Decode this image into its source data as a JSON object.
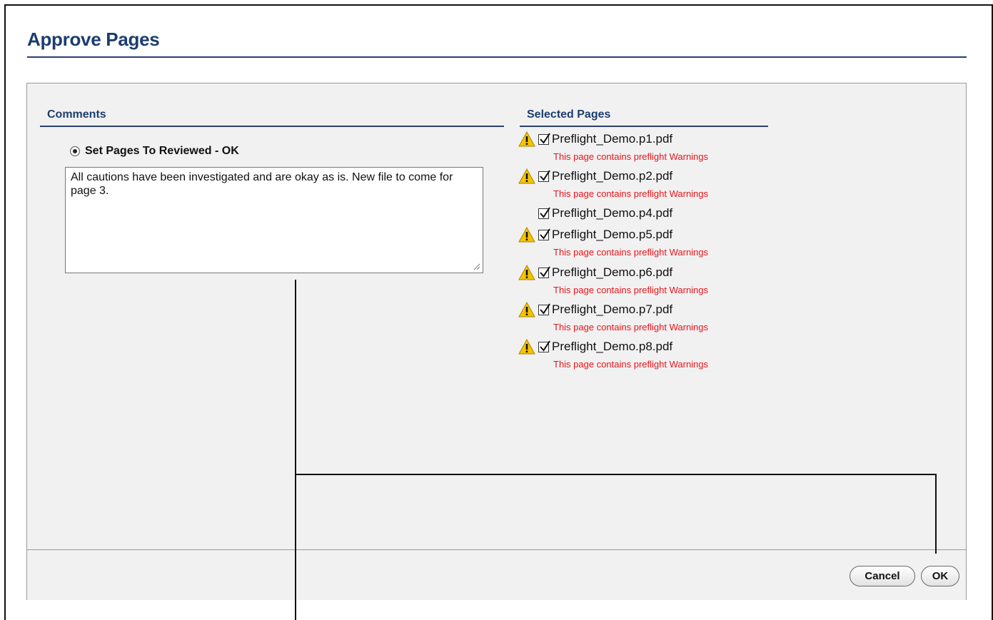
{
  "dialog": {
    "title": "Approve Pages"
  },
  "comments": {
    "heading": "Comments",
    "radio_label": "Set Pages To Reviewed - OK",
    "text": "All cautions have been investigated and are okay as is. New file to come for page 3."
  },
  "selected_pages": {
    "heading": "Selected Pages",
    "warning_text": "This page contains preflight Warnings",
    "items": [
      {
        "name": "Preflight_Demo.p1.pdf",
        "checked": true,
        "warning": "This page contains preflight Warnings"
      },
      {
        "name": "Preflight_Demo.p2.pdf",
        "checked": true,
        "warning": "This page contains preflight Warnings"
      },
      {
        "name": "Preflight_Demo.p4.pdf",
        "checked": true,
        "warning": ""
      },
      {
        "name": "Preflight_Demo.p5.pdf",
        "checked": true,
        "warning": "This page contains preflight Warnings"
      },
      {
        "name": "Preflight_Demo.p6.pdf",
        "checked": true,
        "warning": "This page contains preflight Warnings"
      },
      {
        "name": "Preflight_Demo.p7.pdf",
        "checked": true,
        "warning": "This page contains preflight Warnings"
      },
      {
        "name": "Preflight_Demo.p8.pdf",
        "checked": true,
        "warning": "This page contains preflight Warnings"
      }
    ]
  },
  "footer": {
    "cancel_label": "Cancel",
    "ok_label": "OK"
  },
  "icons": {
    "warning": "warning-triangle-icon",
    "check": "checkmark-icon",
    "radio": "radio-selected-icon"
  },
  "colors": {
    "heading": "#1d3d6e",
    "warning_text": "#e8141a",
    "warning_icon": "#f5c400",
    "panel_bg": "#f1f1f1"
  }
}
